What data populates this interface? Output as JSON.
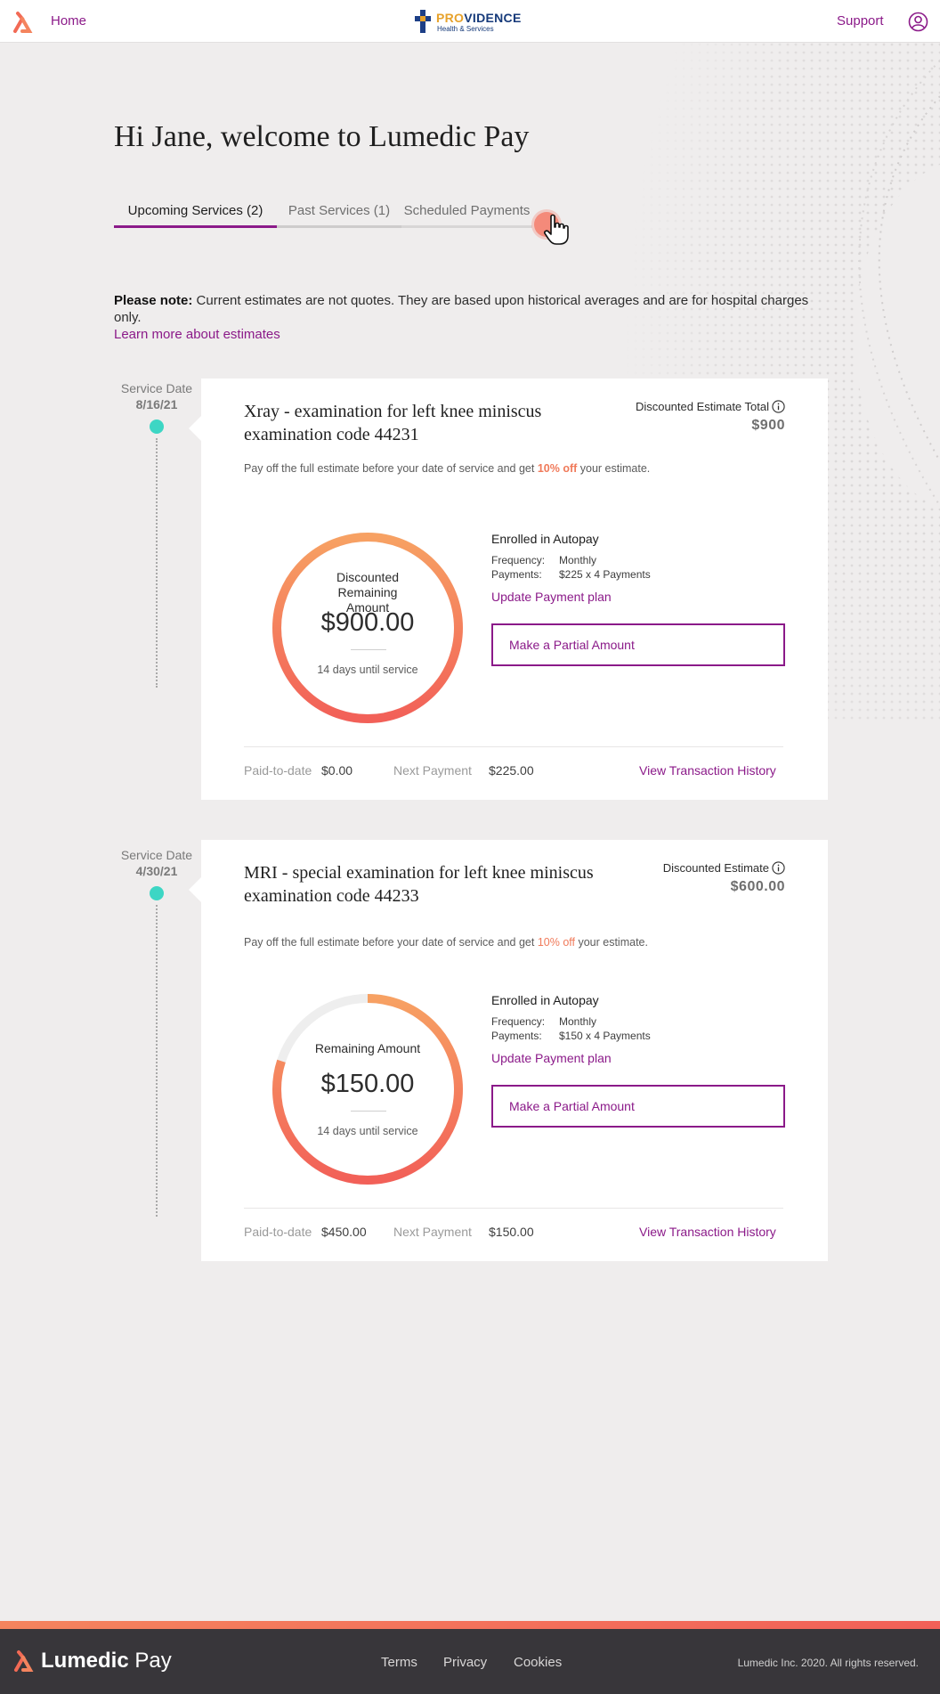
{
  "header": {
    "home_label": "Home",
    "brand_name_part1": "PRO",
    "brand_name_part2": "VIDENCE",
    "brand_sub": "Health & Services",
    "support_label": "Support"
  },
  "greeting": "Hi Jane, welcome to Lumedic Pay",
  "tabs": [
    {
      "label": "Upcoming Services (2)",
      "active": true
    },
    {
      "label": "Past Services (1)",
      "active": false
    },
    {
      "label": "Scheduled Payments",
      "active": false
    }
  ],
  "note": {
    "bold": "Please note:",
    "text": " Current estimates are not quotes. They are based upon historical averages and are for hospital charges only.",
    "link": "Learn more about estimates"
  },
  "services": [
    {
      "service_date_label": "Service Date",
      "service_date": "8/16/21",
      "title": "Xray - examination for left knee miniscus examination code 44231",
      "estimate_label": "Discounted Estimate Total",
      "estimate_value": "$900",
      "promo_pre": "Pay off the full estimate before your date of service and get ",
      "promo_off": "10% off",
      "promo_post": " your estimate.",
      "ring_label": "Discounted Remaining Amount",
      "ring_amount": "$900.00",
      "ring_days": "14 days until service",
      "ring_fill_fraction": 1.0,
      "autopay_title": "Enrolled in Autopay",
      "frequency_key": "Frequency:",
      "frequency_value": "Monthly",
      "payments_key": "Payments:",
      "payments_value": "$225 x 4 Payments",
      "update_link": "Update Payment plan",
      "partial_button": "Make a Partial Amount",
      "paid_label": "Paid-to-date",
      "paid_value": "$0.00",
      "next_label": "Next Payment",
      "next_value": "$225.00",
      "history_link": "View Transaction History"
    },
    {
      "service_date_label": "Service Date",
      "service_date": "4/30/21",
      "title": "MRI - special examination for left knee miniscus examination code 44233",
      "estimate_label": "Discounted Estimate",
      "estimate_value": "$600.00",
      "promo_pre": "Pay off the full estimate before your date of service and get ",
      "promo_off": "10% off",
      "promo_post": " your estimate.",
      "ring_label": "Remaining Amount",
      "ring_amount": "$150.00",
      "ring_days": "14 days until service",
      "ring_fill_fraction": 0.8,
      "autopay_title": "Enrolled in Autopay",
      "frequency_key": "Frequency:",
      "frequency_value": "Monthly",
      "payments_key": "Payments:",
      "payments_value": "$150 x 4 Payments",
      "update_link": "Update Payment plan",
      "partial_button": "Make a Partial Amount",
      "paid_label": "Paid-to-date",
      "paid_value": "$450.00",
      "next_label": "Next Payment",
      "next_value": "$150.00",
      "history_link": "View Transaction History"
    }
  ],
  "footer": {
    "brand_lumedic": "Lumedic",
    "brand_pay": " Pay",
    "links": [
      "Terms",
      "Privacy",
      "Cookies"
    ],
    "copyright": "Lumedic Inc. 2020. All rights reserved."
  },
  "colors": {
    "accent_purple": "#8b1a89",
    "ring_orange": "#f4845e",
    "ring_red": "#f26058",
    "timeline_teal": "#3dd6c4"
  }
}
